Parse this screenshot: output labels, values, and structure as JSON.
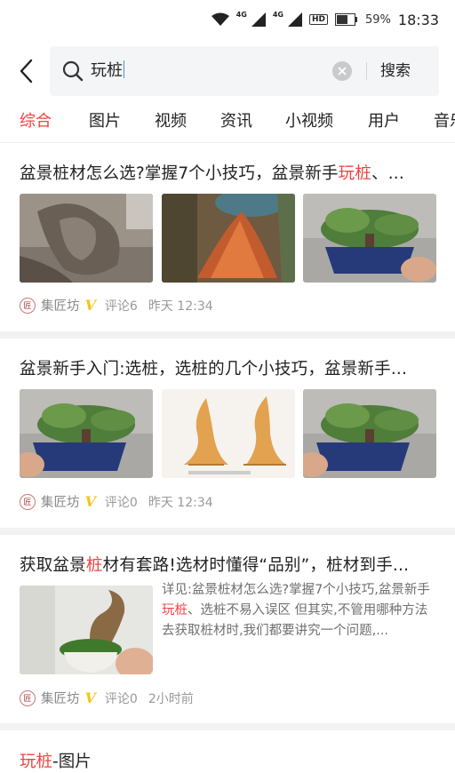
{
  "status_bar": {
    "net1": "4G",
    "net2": "4G",
    "hd": "HD",
    "battery": "59%",
    "time": "18:33",
    "icons": [
      "wifi-icon",
      "signal-icon",
      "battery-icon"
    ]
  },
  "search": {
    "query": "玩桩",
    "button_label": "搜索"
  },
  "tabs": [
    {
      "label": "综合",
      "active": true
    },
    {
      "label": "图片"
    },
    {
      "label": "视频"
    },
    {
      "label": "资讯"
    },
    {
      "label": "小视频"
    },
    {
      "label": "用户"
    },
    {
      "label": "音乐"
    }
  ],
  "results": [
    {
      "title_pre": "盆景桩材怎么选?掌握7个小技巧，盆景新手",
      "title_hl": "玩桩",
      "title_post": "、...",
      "source": "集匠坊",
      "verified": "V",
      "comments": "评论6",
      "time": "昨天 12:34"
    },
    {
      "title_pre": "盆景新手入门:选桩，选桩的几个小技巧，盆景新手...",
      "title_hl": "",
      "title_post": "",
      "source": "集匠坊",
      "verified": "V",
      "comments": "评论0",
      "time": "昨天 12:34"
    },
    {
      "title_pre": "获取盆景",
      "title_hl": "桩",
      "title_post": "材有套路!选材时懂得“品别”，桩材到手...",
      "summary_pre": "详见:盆景桩材怎么选?掌握7个小技巧,盆景新手",
      "summary_hl": "玩桩",
      "summary_post": "、选桩不易入误区 但其实,不管用哪种方法去获取桩材时,我们都要讲究一个问题,...",
      "source": "集匠坊",
      "verified": "V",
      "comments": "评论0",
      "time": "2小时前"
    }
  ],
  "image_section": {
    "title_hl": "玩桩",
    "title_post": "-图片"
  },
  "colors": {
    "accent": "#f04142",
    "verified": "#f5c518",
    "meta": "#999999"
  }
}
